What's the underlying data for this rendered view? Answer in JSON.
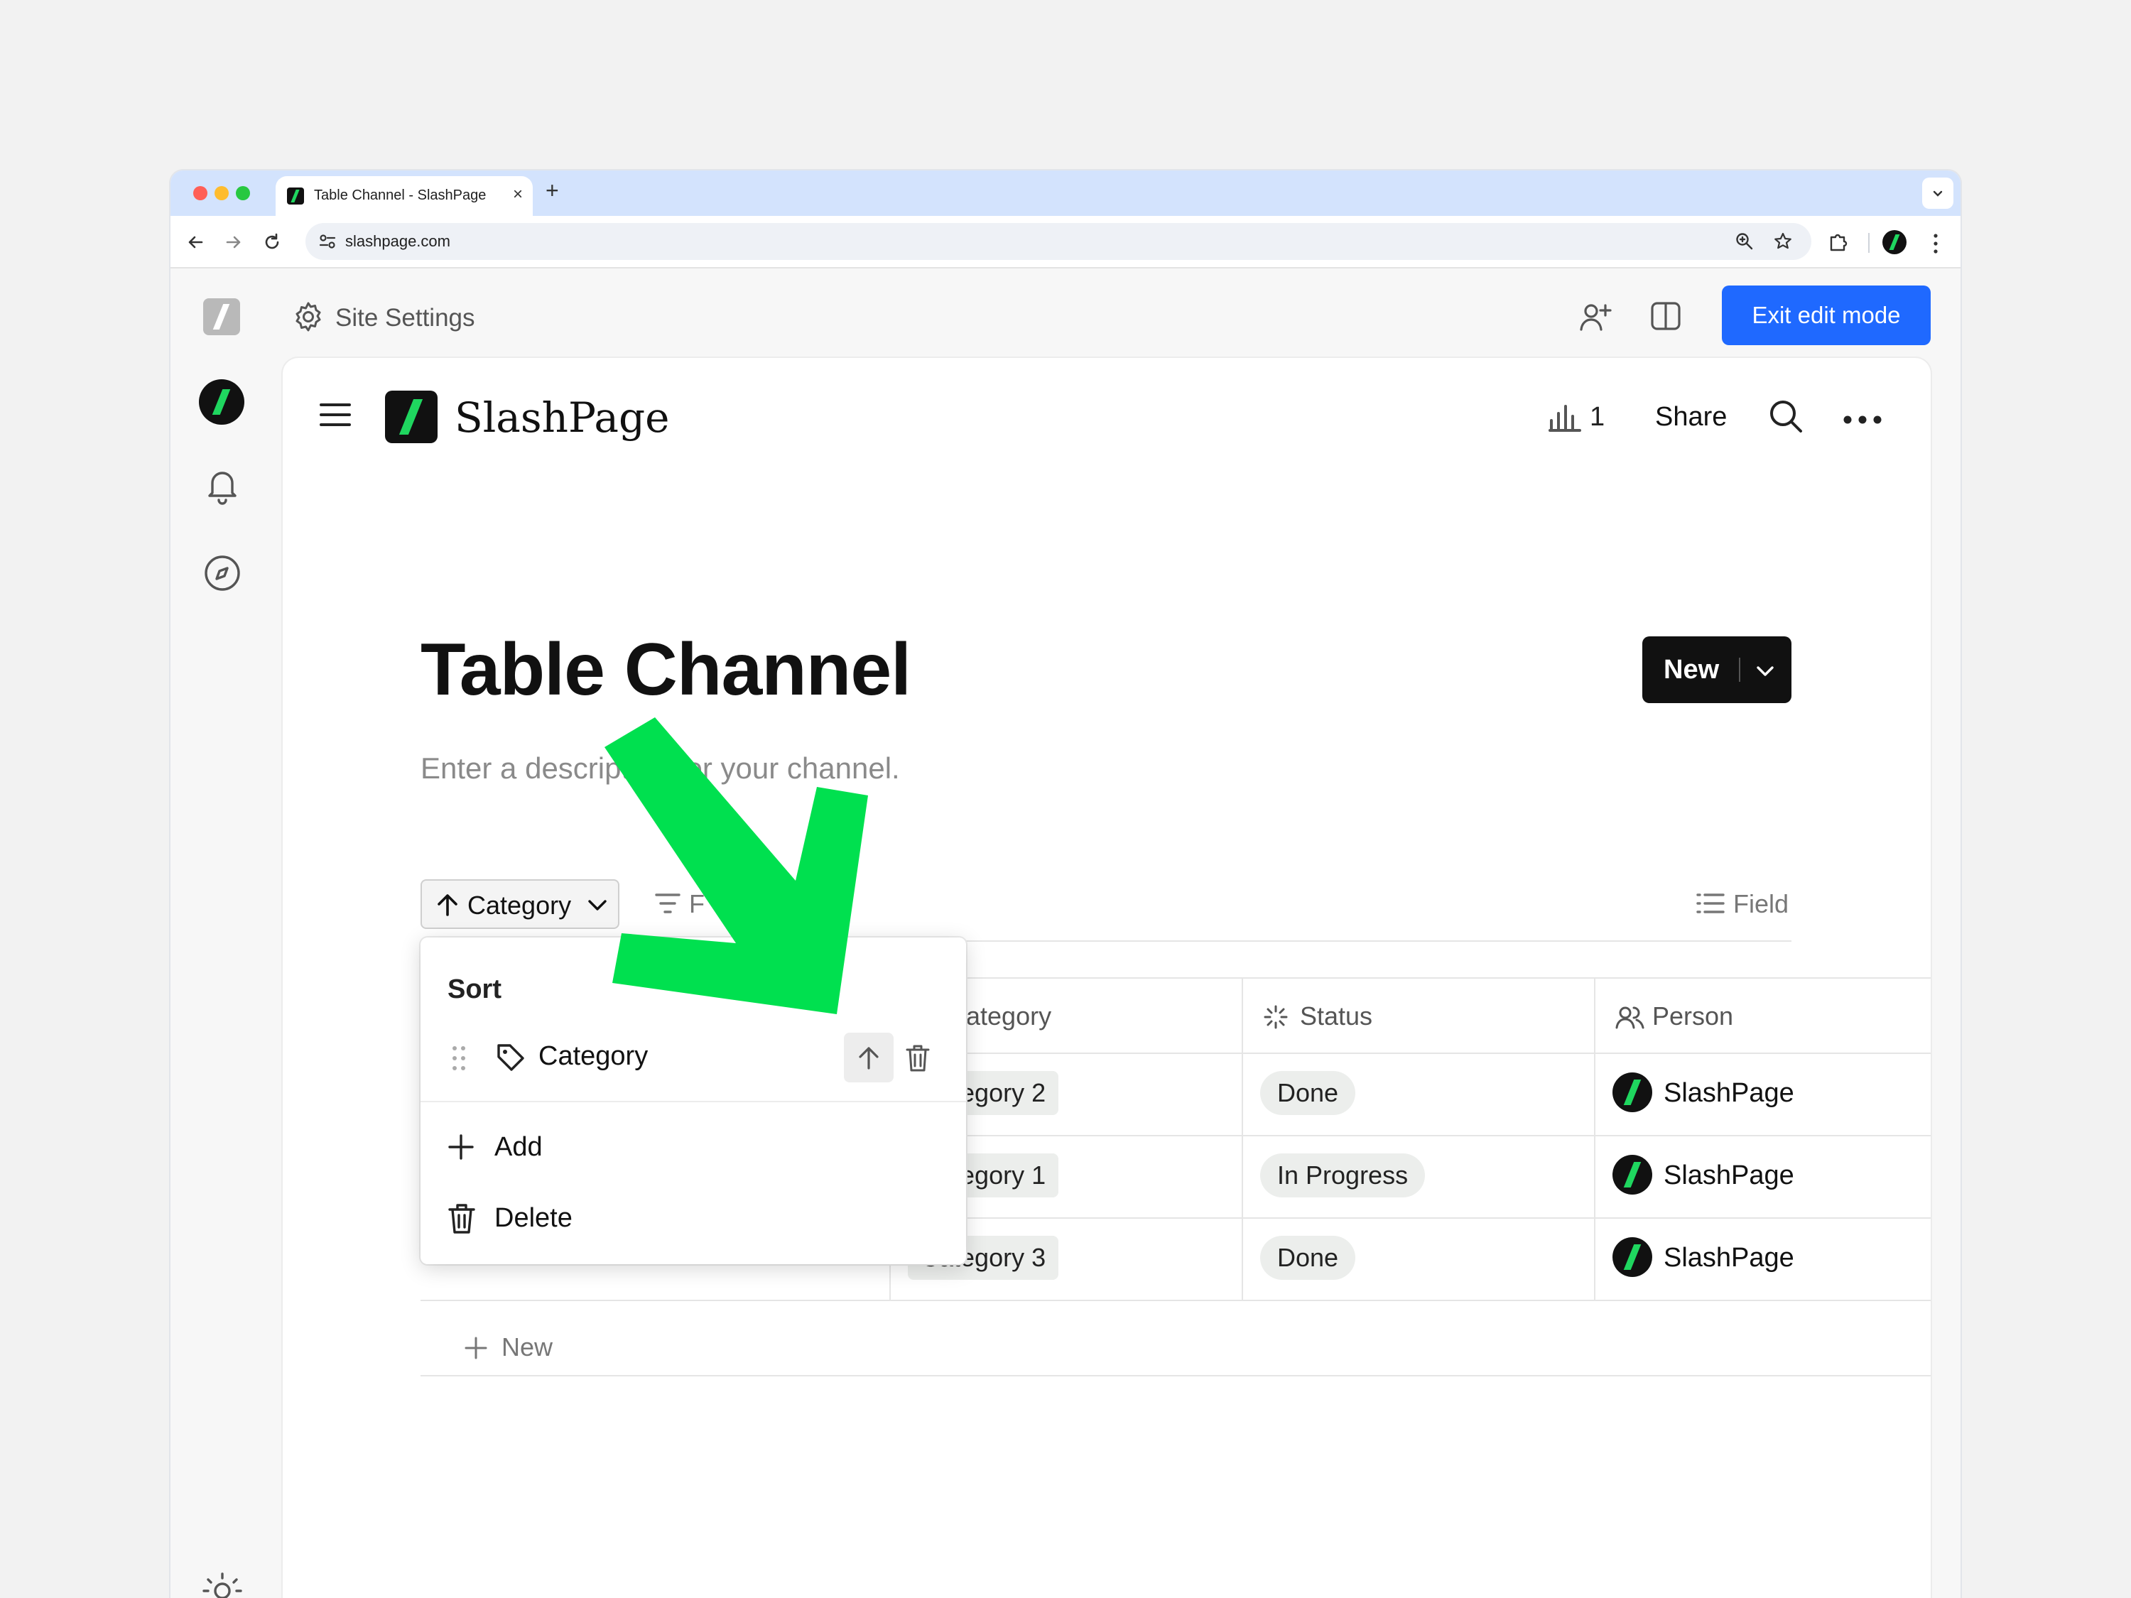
{
  "browser": {
    "tab_title": "Table Channel - SlashPage",
    "url": "slashpage.com",
    "new_tab": "+",
    "close_tab": "×"
  },
  "app": {
    "site_settings_label": "Site Settings",
    "exit_edit_mode_label": "Exit edit mode"
  },
  "page_header": {
    "brand_name": "SlashPage",
    "stats_count": "1",
    "share_label": "Share"
  },
  "channel": {
    "title": "Table Channel",
    "description": "Enter a description for your channel.",
    "new_button_label": "New"
  },
  "toolbar": {
    "sort_chip_label": "Category",
    "filter_label": "F",
    "field_label": "Field"
  },
  "table": {
    "columns": [
      {
        "label": "Category",
        "icon": "tag-icon"
      },
      {
        "label": "Status",
        "icon": "loader-icon"
      },
      {
        "label": "Person",
        "icon": "people-icon"
      }
    ],
    "rows": [
      {
        "category": "Category 2",
        "status": "Done",
        "person": "SlashPage"
      },
      {
        "category": "Category 1",
        "status": "In Progress",
        "person": "SlashPage"
      },
      {
        "category": "Category 3",
        "status": "Done",
        "person": "SlashPage"
      }
    ],
    "add_row_label": "New"
  },
  "sort_popover": {
    "title": "Sort",
    "rule_field": "Category",
    "rule_direction": "ascending",
    "add_label": "Add",
    "delete_label": "Delete"
  },
  "annotation": {
    "arrow_color": "#00e04f",
    "points_to": "sort-direction-button"
  },
  "colors": {
    "accent_blue": "#1f69ff",
    "brand_green": "#1fd65f",
    "brand_black": "#111111"
  }
}
